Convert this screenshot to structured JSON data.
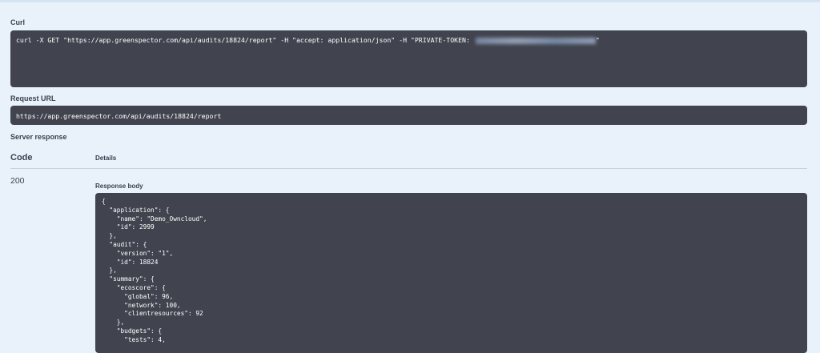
{
  "curl": {
    "label": "Curl",
    "command": "curl -X GET \"https://app.greenspector.com/api/audits/18824/report\" -H \"accept: application/json\" -H \"PRIVATE-TOKEN: ",
    "command_end": "\""
  },
  "request_url": {
    "label": "Request URL",
    "value": "https://app.greenspector.com/api/audits/18824/report"
  },
  "server_response": {
    "label": "Server response",
    "code_header": "Code",
    "details_header": "Details",
    "status_code": "200",
    "body_label": "Response body",
    "body_lines": [
      "{",
      "  \"application\": {",
      "    \"name\": \"Demo_Owncloud\",",
      "    \"id\": 2999",
      "  },",
      "  \"audit\": {",
      "    \"version\": \"1\",",
      "    \"id\": 18824",
      "  },",
      "  \"summary\": {",
      "    \"ecoscore\": {",
      "      \"global\": 96,",
      "      \"network\": 100,",
      "      \"clientresources\": 92",
      "    },",
      "    \"budgets\": {",
      "      \"tests\": 4,"
    ]
  },
  "colors": {
    "page_background": "#e9f2fb",
    "code_background": "#41444e",
    "text": "#3b4151"
  }
}
